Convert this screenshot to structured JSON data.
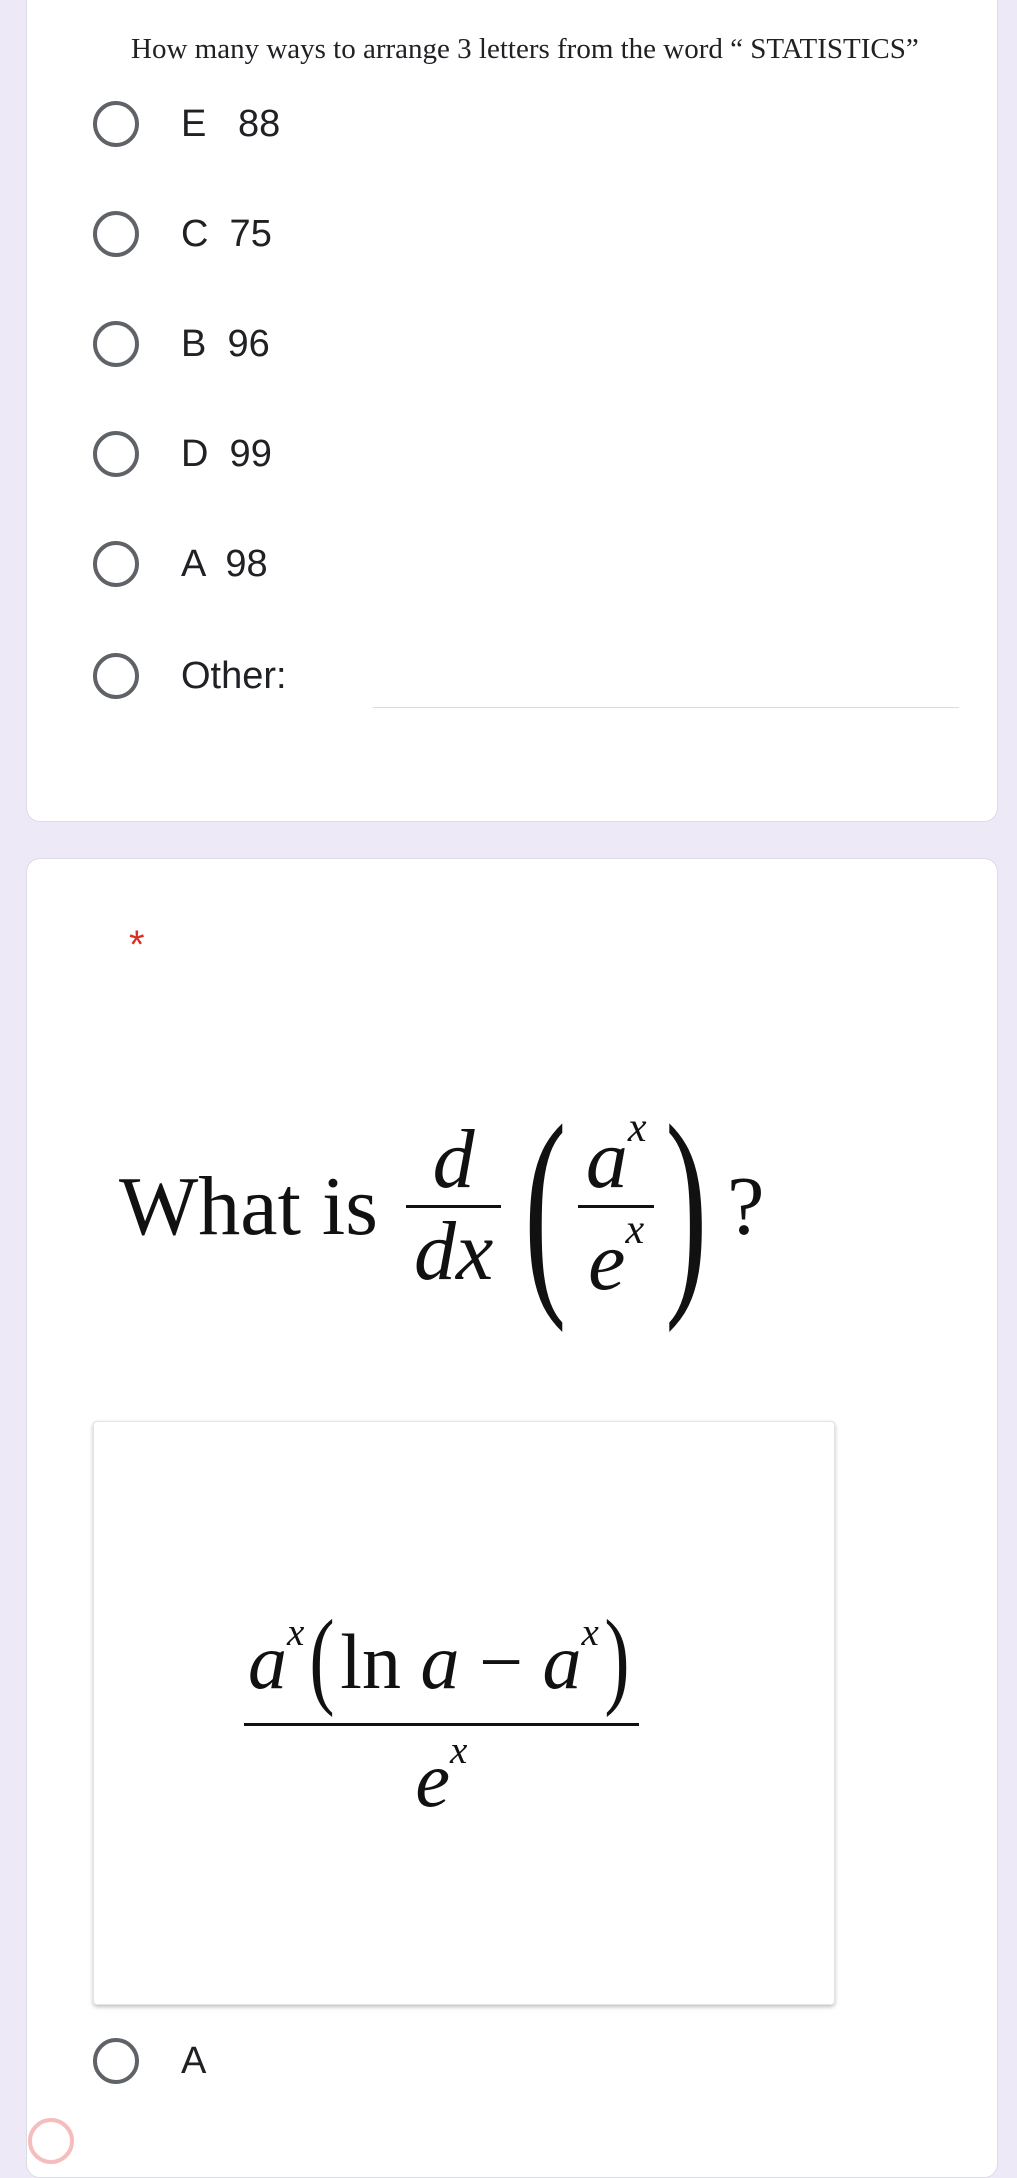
{
  "question1": {
    "text": "How many ways to arrange 3 letters from the word “ STATISTICS”",
    "options": [
      {
        "label": "E   88"
      },
      {
        "label": "C  75"
      },
      {
        "label": "B  96"
      },
      {
        "label": "D  99"
      },
      {
        "label": "A  98"
      }
    ],
    "other_label": "Other:",
    "other_value": ""
  },
  "question2": {
    "required_mark": "*",
    "text_prefix": "What is",
    "text_suffix": "?",
    "derivative_num": "d",
    "derivative_den": "dx",
    "inner_num_base": "a",
    "inner_den_base": "e",
    "exponent": "x",
    "image_formula": {
      "numerator_base": "a",
      "exponent": "x",
      "ln": "ln",
      "a": "a",
      "minus": "−",
      "denominator_base": "e"
    },
    "options": [
      {
        "label": "A"
      }
    ]
  }
}
